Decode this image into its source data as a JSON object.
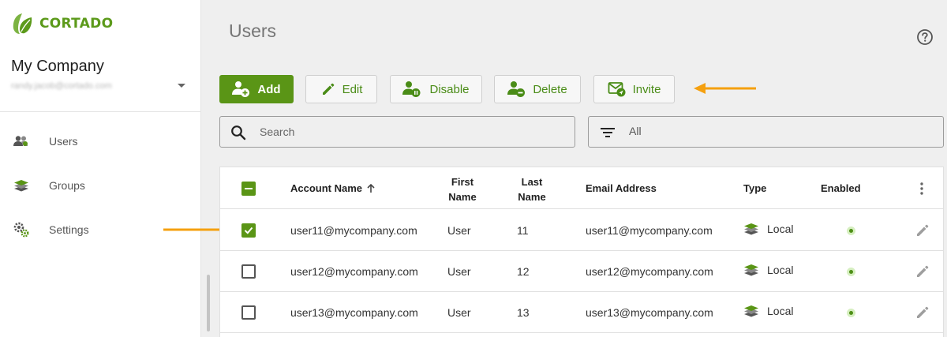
{
  "brand": {
    "name": "CORTADO",
    "color": "#5c9a1b"
  },
  "account": {
    "company": "My Company",
    "email": "randy.jacob@cortado.com"
  },
  "sidebar": {
    "items": [
      {
        "label": "Users",
        "icon": "users-icon"
      },
      {
        "label": "Groups",
        "icon": "layers-icon"
      },
      {
        "label": "Settings",
        "icon": "gears-icon"
      }
    ]
  },
  "page": {
    "title": "Users"
  },
  "toolbar": {
    "add_label": "Add",
    "edit_label": "Edit",
    "disable_label": "Disable",
    "delete_label": "Delete",
    "invite_label": "Invite"
  },
  "search": {
    "placeholder": "Search"
  },
  "filter": {
    "value": "All"
  },
  "table": {
    "columns": {
      "account_name": "Account Name",
      "first_name": "First Name",
      "last_name": "Last Name",
      "email": "Email Address",
      "type": "Type",
      "enabled": "Enabled"
    },
    "rows": [
      {
        "account": "user11@mycompany.com",
        "first": "User",
        "last": "11",
        "email": "user11@mycompany.com",
        "type": "Local",
        "enabled": true,
        "checked": true
      },
      {
        "account": "user12@mycompany.com",
        "first": "User",
        "last": "12",
        "email": "user12@mycompany.com",
        "type": "Local",
        "enabled": true,
        "checked": false
      },
      {
        "account": "user13@mycompany.com",
        "first": "User",
        "last": "13",
        "email": "user13@mycompany.com",
        "type": "Local",
        "enabled": true,
        "checked": false
      }
    ]
  },
  "colors": {
    "accent": "#5a9516",
    "annotation_arrow": "#f5a00f"
  }
}
